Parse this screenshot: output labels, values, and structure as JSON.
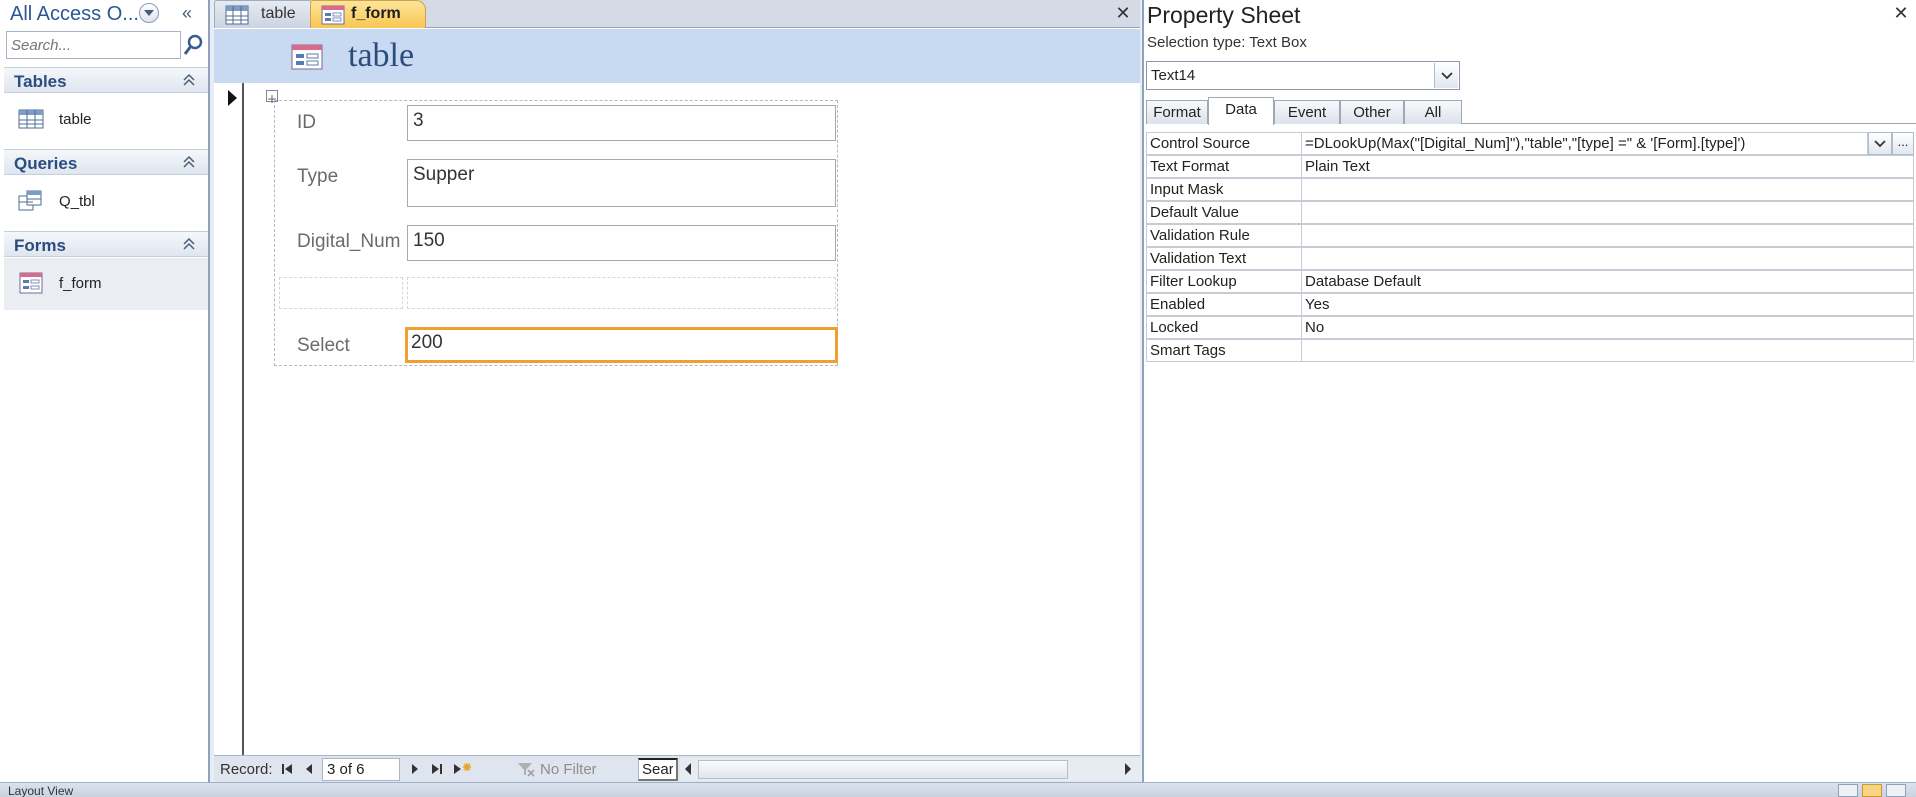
{
  "nav": {
    "title": "All Access O...",
    "search_placeholder": "Search...",
    "groups": [
      {
        "label": "Tables",
        "items": [
          {
            "label": "table",
            "icon": "table-icon"
          }
        ]
      },
      {
        "label": "Queries",
        "items": [
          {
            "label": "Q_tbl",
            "icon": "query-icon"
          }
        ]
      },
      {
        "label": "Forms",
        "items": [
          {
            "label": "f_form",
            "icon": "form-icon"
          }
        ]
      }
    ]
  },
  "document": {
    "tabs": [
      {
        "label": "table",
        "icon": "table-icon",
        "active": false
      },
      {
        "label": "f_form",
        "icon": "form-icon",
        "active": true
      }
    ],
    "form_title": "table",
    "fields": [
      {
        "label": "ID",
        "value": "3"
      },
      {
        "label": "Type",
        "value": "Supper"
      },
      {
        "label": "Digital_Num",
        "value": "150"
      },
      {
        "label": "Select",
        "value": "200"
      }
    ],
    "record_nav": {
      "label": "Record:",
      "current": "3 of 6",
      "filter": "No Filter",
      "search": "Search"
    }
  },
  "property_sheet": {
    "title": "Property Sheet",
    "selection_type": "Selection type:  Text Box",
    "object": "Text14",
    "tabs": [
      "Format",
      "Data",
      "Event",
      "Other",
      "All"
    ],
    "active_tab": "Data",
    "rows": [
      {
        "name": "Control Source",
        "value": "=DLookUp(Max(\"[Digital_Num]\"),\"table\",\"[type] =\" & '[Form].[type]')"
      },
      {
        "name": "Text Format",
        "value": "Plain Text"
      },
      {
        "name": "Input Mask",
        "value": ""
      },
      {
        "name": "Default Value",
        "value": ""
      },
      {
        "name": "Validation Rule",
        "value": ""
      },
      {
        "name": "Validation Text",
        "value": ""
      },
      {
        "name": "Filter Lookup",
        "value": "Database Default"
      },
      {
        "name": "Enabled",
        "value": "Yes"
      },
      {
        "name": "Locked",
        "value": "No"
      },
      {
        "name": "Smart Tags",
        "value": ""
      }
    ],
    "build_button": "..."
  },
  "status_bar": {
    "text": "Layout View"
  },
  "colors": {
    "accent": "#f1a02f",
    "header_band": "#c8daf1",
    "active_tab": "#f7c652",
    "nav_heading": "#2a4d80"
  }
}
